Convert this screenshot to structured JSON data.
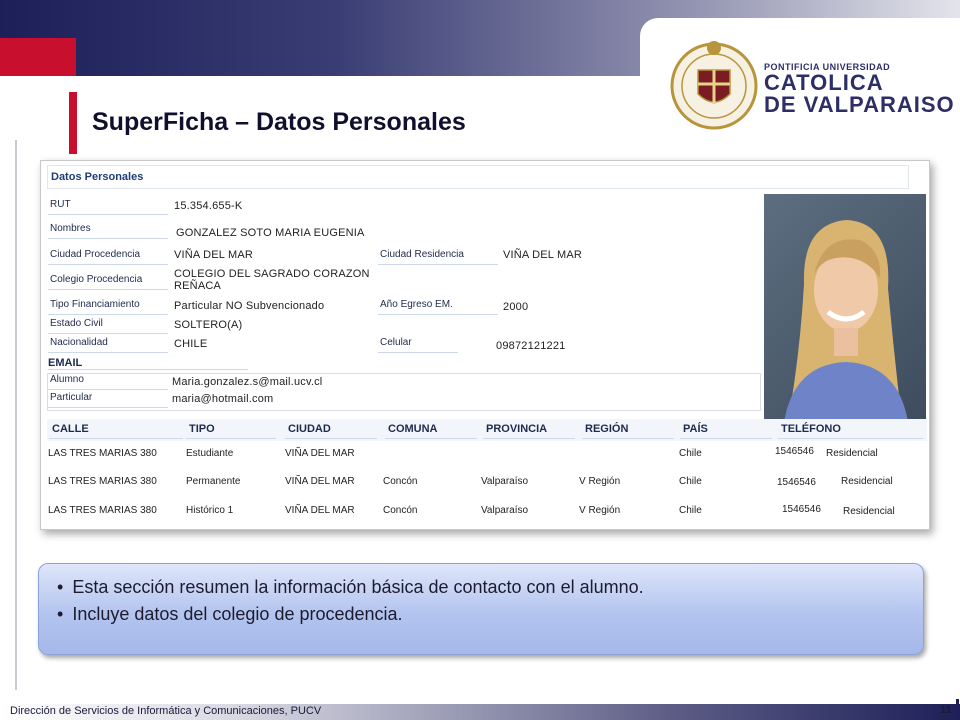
{
  "slide": {
    "title": "SuperFicha –  Datos Personales",
    "page_number": "11",
    "footer": "Dirección de Servicios de Informática y Comunicaciones, PUCV"
  },
  "logo": {
    "line1": "PONTIFICIA UNIVERSIDAD",
    "line2": "CATOLICA",
    "line3": "DE VALPARAISO"
  },
  "form": {
    "section_title": "Datos Personales",
    "rut_label": "RUT",
    "rut": "15.354.655-K",
    "nombres_label": "Nombres",
    "nombres": "GONZALEZ SOTO MARIA EUGENIA",
    "ciudad_procedencia_label": "Ciudad Procedencia",
    "ciudad_procedencia": "VIÑA DEL MAR",
    "ciudad_residencia_label": "Ciudad Residencia",
    "ciudad_residencia": "VIÑA DEL MAR",
    "colegio_label": "Colegio Procedencia",
    "colegio_line1": "COLEGIO DEL SAGRADO CORAZON",
    "colegio_line2": "REÑACA",
    "financiamiento_label": "Tipo Financiamiento",
    "financiamiento": "Particular NO Subvencionado",
    "egreso_label": "Año Egreso EM.",
    "egreso": "2000",
    "estado_civil_label": "Estado Civil",
    "estado_civil": "SOLTERO(A)",
    "nacionalidad_label": "Nacionalidad",
    "nacionalidad": "CHILE",
    "celular_label": "Celular",
    "celular": "09872121221",
    "email_section": "EMAIL",
    "alumno_label": "Alumno",
    "alumno_email": "Maria.gonzalez.s@mail.ucv.cl",
    "particular_label": "Particular",
    "particular_email": "maria@hotmail.com"
  },
  "address_table": {
    "headers": [
      "CALLE",
      "TIPO",
      "CIUDAD",
      "COMUNA",
      "PROVINCIA",
      "REGIÓN",
      "PAÍS",
      "TELÉFONO"
    ],
    "rows": [
      [
        "LAS TRES MARIAS 380",
        "Estudiante",
        "VIÑA DEL MAR",
        "",
        "",
        "",
        "Chile",
        "1546546",
        "Residencial"
      ],
      [
        "LAS TRES MARIAS 380",
        "Permanente",
        "VIÑA DEL MAR",
        "Concón",
        "Valparaíso",
        "V Región",
        "Chile",
        "1546546",
        "Residencial"
      ],
      [
        "LAS TRES MARIAS 380",
        "Histórico 1",
        "VIÑA DEL MAR",
        "Concón",
        "Valparaíso",
        "V Región",
        "Chile",
        "1546546",
        "Residencial"
      ]
    ]
  },
  "bullets": [
    "Esta sección resumen la información básica de contacto con el alumno.",
    "Incluye datos del colegio de procedencia."
  ],
  "colors": {
    "navy": "#1d1f58",
    "red": "#c8102e",
    "callout_blue": "#b3c4ef"
  }
}
